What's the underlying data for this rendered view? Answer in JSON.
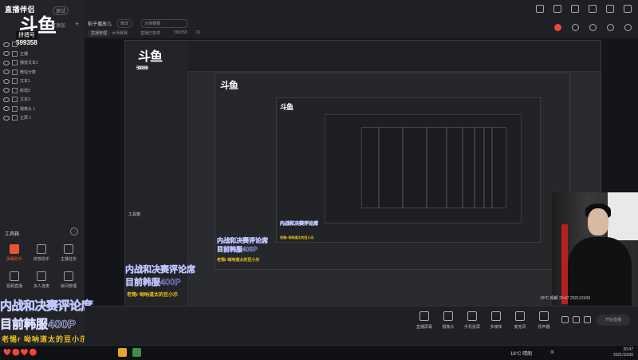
{
  "app": {
    "logo_text": "直播伴侣",
    "badge": "测试",
    "platform": "斗鱼",
    "sub_label": "拼搏号",
    "room_id": "599358"
  },
  "sidebar": {
    "scene_label": "可添加",
    "sources": [
      {
        "label": ""
      },
      {
        "label": "主播"
      },
      {
        "label": "播放文本1"
      },
      {
        "label": "微信分数"
      },
      {
        "label": "文本1"
      },
      {
        "label": "新增2"
      },
      {
        "label": "文本3"
      },
      {
        "label": "摄像头 1"
      },
      {
        "label": "主屏 1"
      }
    ],
    "tools_title": "工具箱",
    "tools": [
      {
        "label": "弹幕助手"
      },
      {
        "label": "房管助手"
      },
      {
        "label": "主播任务"
      },
      {
        "label": "视频直播"
      },
      {
        "label": "多人连麦"
      },
      {
        "label": "房间管理"
      }
    ]
  },
  "topbar": {
    "room_title": "稻子播放儿",
    "edit_label": "修改",
    "category": "大师赛赛",
    "tag": "直播管理",
    "tag2": "大师赛赛",
    "meta1": "直播已暂停",
    "room_id": "599358",
    "count": "62"
  },
  "overlay": {
    "title": "内战和决赛评论席",
    "subtitle": "目前韩服400P",
    "yellow": "老惕r 呦呐道太的豆小示"
  },
  "bottombar": {
    "items": [
      {
        "label": "直播屏幕"
      },
      {
        "label": "摄像头"
      },
      {
        "label": "手机投屏"
      },
      {
        "label": "多媒体"
      },
      {
        "label": "麦克风"
      },
      {
        "label": "扬声器"
      }
    ],
    "start_label": "开始直播"
  },
  "preview": {
    "weather": "18°C 晴朗",
    "clock_time": "20:47",
    "clock_date": "2021/10/30"
  },
  "taskbar": {
    "gifts": "❤️🔴❤️🔴",
    "weather": "18°C 晴朗",
    "tray_label": "英",
    "time": "20:47",
    "date": "2021/10/30"
  }
}
